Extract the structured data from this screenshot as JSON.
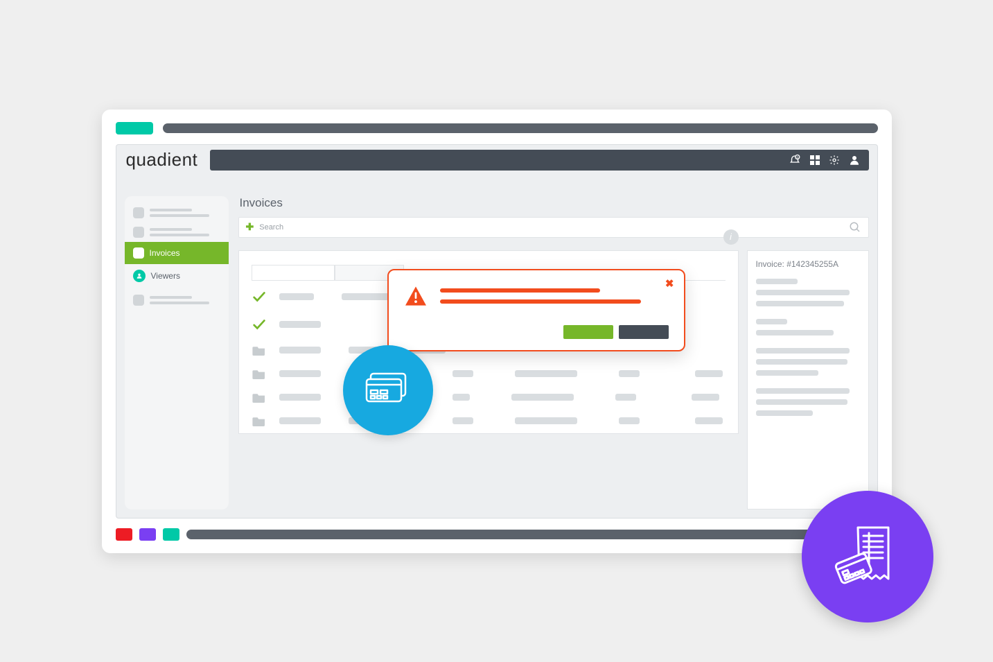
{
  "brand": "quadient",
  "header": {
    "notification_badge": "0"
  },
  "sidebar": {
    "invoices_label": "Invoices",
    "viewers_label": "Viewers"
  },
  "content": {
    "title": "Invoices",
    "search_placeholder": "Search"
  },
  "detail_panel": {
    "invoice_label": "Invoice:",
    "invoice_number": "#142345255A"
  },
  "colors": {
    "teal": "#00C9A7",
    "green": "#76B72A",
    "orange": "#F24C1D",
    "purple": "#7A3FF2",
    "blue": "#17A9E0",
    "red": "#ED1C24",
    "grey_dark": "#5B626B"
  }
}
